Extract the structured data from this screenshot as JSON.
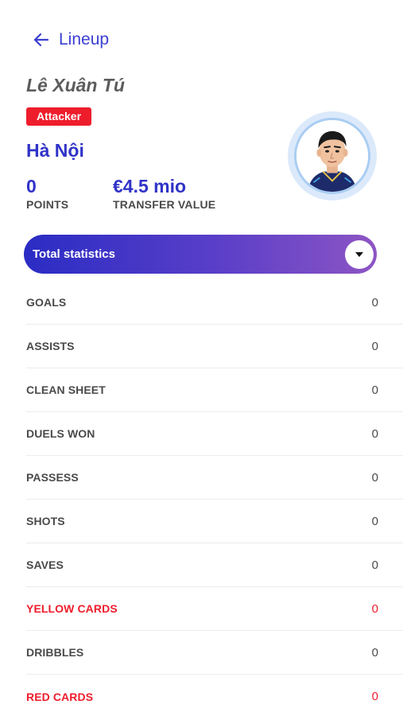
{
  "header": {
    "back_label": "Lineup"
  },
  "player": {
    "name": "Lê Xuân Tú",
    "position_badge": "Attacker",
    "club": "Hà Nội",
    "points_value": "0",
    "points_label": "POINTS",
    "transfer_value": "€4.5 mio",
    "transfer_label": "TRANSFER VALUE"
  },
  "total_stats": {
    "title": "Total statistics"
  },
  "stats": [
    {
      "name": "GOALS",
      "value": "0"
    },
    {
      "name": "ASSISTS",
      "value": "0"
    },
    {
      "name": "CLEAN SHEET",
      "value": "0"
    },
    {
      "name": "DUELS WON",
      "value": "0"
    },
    {
      "name": "PASSESS",
      "value": "0"
    },
    {
      "name": "SHOTS",
      "value": "0"
    },
    {
      "name": "SAVES",
      "value": "0"
    },
    {
      "name": "YELLOW CARDS",
      "value": "0"
    },
    {
      "name": "DRIBBLES",
      "value": "0"
    },
    {
      "name": "RED CARDS",
      "value": "0"
    }
  ],
  "colors": {
    "accent": "#3033c8",
    "badge_red": "#ee1d2c",
    "gradient_start": "#2a2cc4",
    "gradient_end": "#8d55c4"
  },
  "icons": {
    "back": "arrow-left-icon",
    "dropdown": "chevron-down-icon",
    "avatar": "player-avatar"
  }
}
